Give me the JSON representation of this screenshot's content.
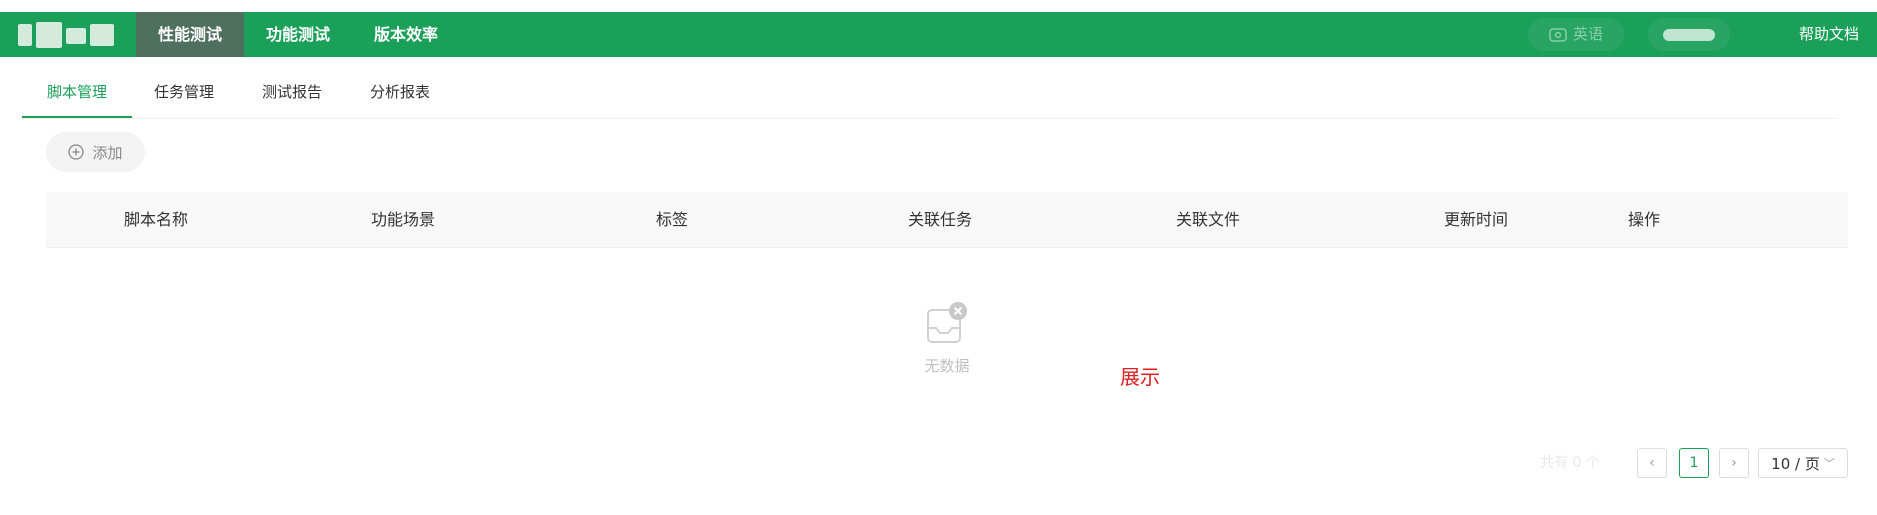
{
  "topbar": {
    "nav": [
      {
        "label": "性能测试",
        "active": true
      },
      {
        "label": "功能测试",
        "active": false
      },
      {
        "label": "版本效率",
        "active": false
      }
    ],
    "language_label": "英语",
    "help_label": "帮助文档",
    "accent_color": "#1ba05a"
  },
  "tabs": [
    {
      "label": "脚本管理",
      "active": true
    },
    {
      "label": "任务管理",
      "active": false
    },
    {
      "label": "测试报告",
      "active": false
    },
    {
      "label": "分析报表",
      "active": false
    }
  ],
  "toolbar": {
    "add_label": "添加"
  },
  "table": {
    "headers": [
      "脚本名称",
      "功能场景",
      "标签",
      "关联任务",
      "关联文件",
      "更新时间",
      "操作"
    ],
    "empty_text": "无数据"
  },
  "annotation": "展示",
  "pagination": {
    "total_text": "共有 0 个",
    "current_page": "1",
    "page_size": "10 / 页"
  }
}
